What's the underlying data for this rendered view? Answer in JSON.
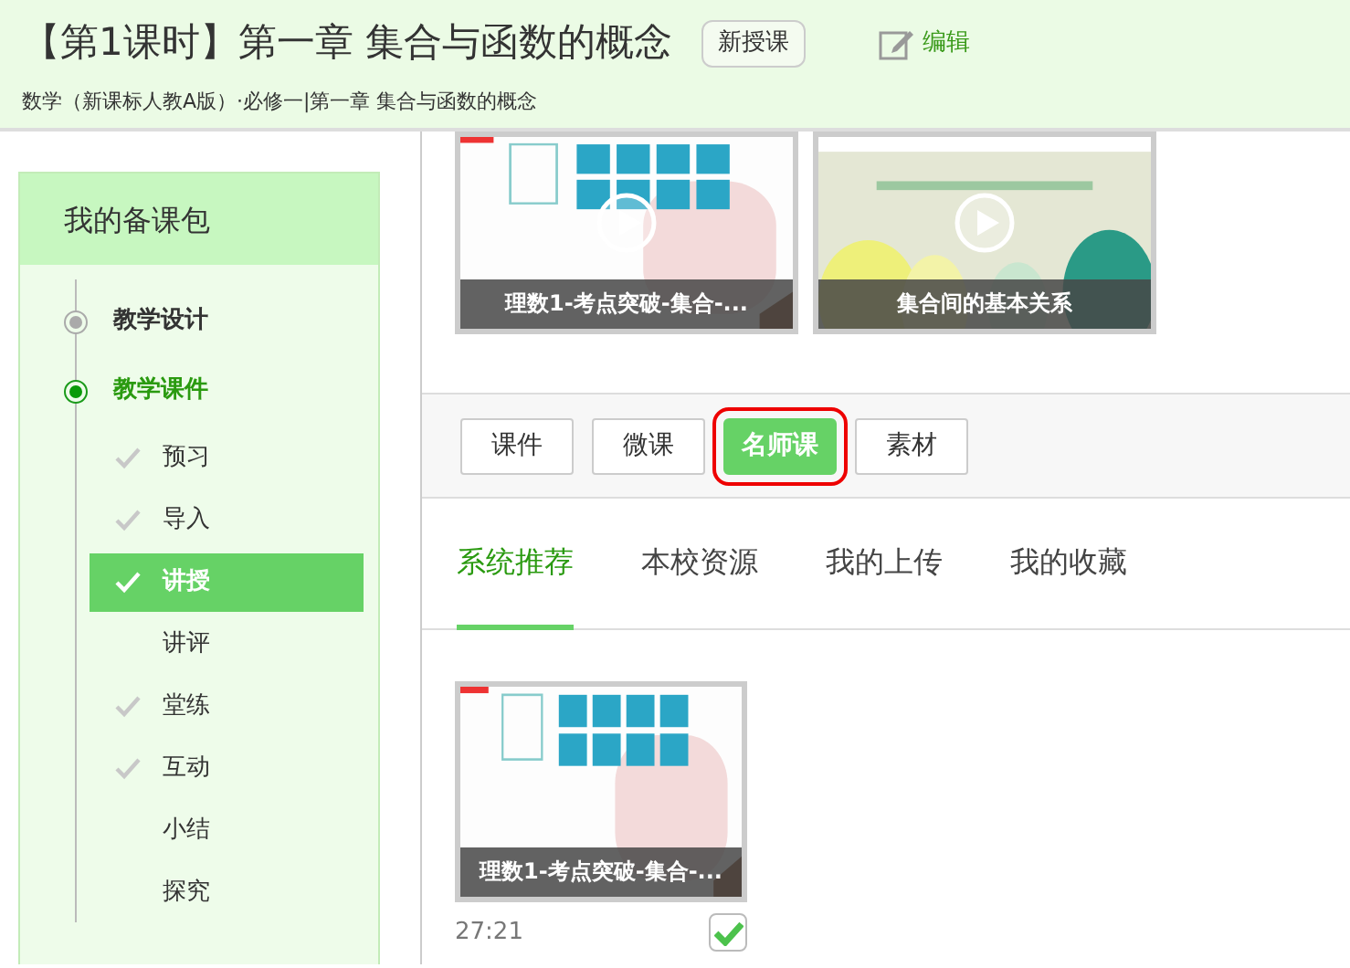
{
  "header": {
    "title": "【第1课时】第一章 集合与函数的概念",
    "badge": "新授课",
    "edit": "编辑",
    "breadcrumb": "数学（新课标人教A版）·必修一|第一章 集合与函数的概念"
  },
  "sidebar": {
    "title": "我的备课包",
    "items": [
      {
        "label": "教学设计",
        "selected": false
      },
      {
        "label": "教学课件",
        "selected": true,
        "children": [
          {
            "label": "预习",
            "checked": true,
            "selected": false
          },
          {
            "label": "导入",
            "checked": true,
            "selected": false
          },
          {
            "label": "讲授",
            "checked": true,
            "selected": true
          },
          {
            "label": "讲评",
            "checked": false,
            "selected": false
          },
          {
            "label": "堂练",
            "checked": true,
            "selected": false
          },
          {
            "label": "互动",
            "checked": true,
            "selected": false
          },
          {
            "label": "小结",
            "checked": false,
            "selected": false
          },
          {
            "label": "探究",
            "checked": false,
            "selected": false
          }
        ]
      }
    ]
  },
  "top_videos": [
    {
      "caption": "理数1-考点突破-集合-..."
    },
    {
      "caption": "集合间的基本关系"
    }
  ],
  "type_buttons": [
    {
      "label": "课件",
      "selected": false,
      "outlined": false
    },
    {
      "label": "微课",
      "selected": false,
      "outlined": false
    },
    {
      "label": "名师课",
      "selected": true,
      "outlined": true
    },
    {
      "label": "素材",
      "selected": false,
      "outlined": false
    }
  ],
  "source_tabs": [
    {
      "label": "系统推荐",
      "selected": true
    },
    {
      "label": "本校资源",
      "selected": false
    },
    {
      "label": "我的上传",
      "selected": false
    },
    {
      "label": "我的收藏",
      "selected": false
    }
  ],
  "results": [
    {
      "caption": "理数1-考点突破-集合-...",
      "duration": "27:21",
      "checked": true
    }
  ]
}
